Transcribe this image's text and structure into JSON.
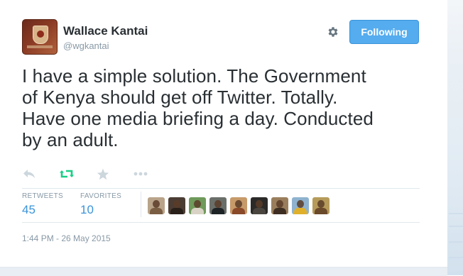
{
  "user": {
    "display_name": "Wallace Kantai",
    "screen_name": "@wgkantai",
    "avatar_icon": "crest-avatar-icon"
  },
  "header": {
    "settings_icon": "gear-icon",
    "follow_label": "Following",
    "accent_color": "#55acee"
  },
  "tweet": {
    "text": "I have a simple solution. The Government\nof Kenya should get off Twitter. Totally.\nHave one media briefing a day. Conducted\nby an adult.",
    "timestamp": "1:44 PM - 26 May 2015"
  },
  "actions": [
    {
      "name": "reply-icon",
      "glyph": "↰"
    },
    {
      "name": "retweet-icon",
      "glyph": "⇄",
      "color": "#19cf86"
    },
    {
      "name": "favorite-icon",
      "glyph": "★"
    },
    {
      "name": "more-icon",
      "glyph": "•••"
    }
  ],
  "stats": {
    "retweets_label": "RETWEETS",
    "retweets_value": "45",
    "favorites_label": "FAVORITES",
    "favorites_value": "10"
  },
  "favoriters": [
    {
      "bg": "#b9a48a",
      "body": "#7a5e44"
    },
    {
      "bg": "#4b3d33",
      "body": "#2a201a"
    },
    {
      "bg": "#6f9a5a",
      "body": "#d9d3c6"
    },
    {
      "bg": "#6b6f6a",
      "body": "#1e2426"
    },
    {
      "bg": "#c79a6a",
      "body": "#8a4a2a"
    },
    {
      "bg": "#2c2a28",
      "body": "#4a463f"
    },
    {
      "bg": "#9a7e5c",
      "body": "#3e2e22"
    },
    {
      "bg": "#8fb3cf",
      "body": "#e0b02a"
    },
    {
      "bg": "#b59a5a",
      "body": "#6a4a2a"
    }
  ]
}
